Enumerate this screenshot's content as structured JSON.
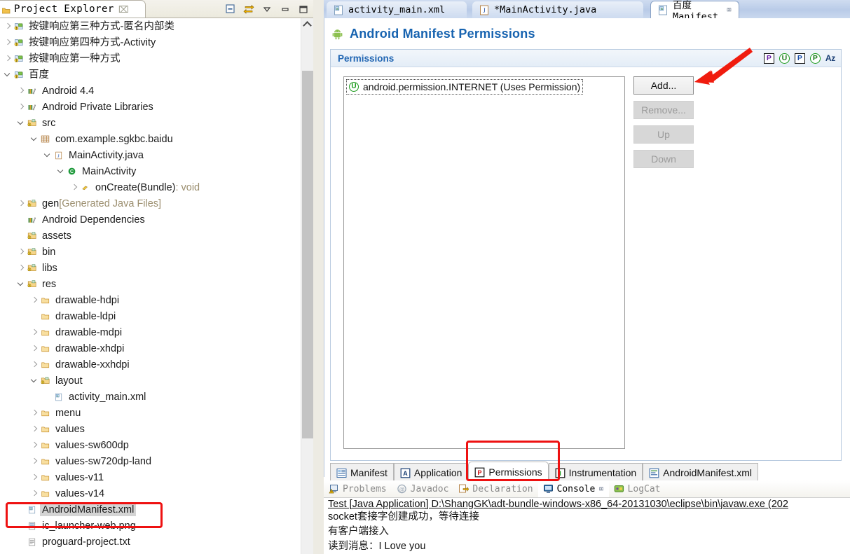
{
  "explorer": {
    "tab_label": "Project Explorer",
    "tab_close": "⌧",
    "toolbar": [
      {
        "name": "collapse-all-icon",
        "title": "Collapse All"
      },
      {
        "name": "link-with-editor-icon",
        "title": "Link with Editor"
      },
      {
        "name": "view-menu-icon",
        "title": "View Menu"
      },
      {
        "name": "minimize-icon",
        "title": "Minimize"
      },
      {
        "name": "maximize-icon",
        "title": "Maximize"
      }
    ],
    "tree": [
      {
        "label": "按键响应第三种方式-匿名内部类",
        "indent": 0,
        "twisty": "collapsed",
        "icon": "android-project",
        "selected": false
      },
      {
        "label": "按键响应第四种方式-Activity",
        "indent": 0,
        "twisty": "collapsed",
        "icon": "android-project",
        "selected": false
      },
      {
        "label": "按键响应第一种方式",
        "indent": 0,
        "twisty": "collapsed",
        "icon": "android-project",
        "selected": false
      },
      {
        "label": "百度",
        "indent": 0,
        "twisty": "expanded",
        "icon": "android-project",
        "selected": false
      },
      {
        "label": "Android 4.4",
        "indent": 1,
        "twisty": "collapsed",
        "icon": "library",
        "selected": false
      },
      {
        "label": "Android Private Libraries",
        "indent": 1,
        "twisty": "collapsed",
        "icon": "library",
        "selected": false
      },
      {
        "label": "src",
        "indent": 1,
        "twisty": "expanded",
        "icon": "source-folder",
        "selected": false
      },
      {
        "label": "com.example.sgkbc.baidu",
        "indent": 2,
        "twisty": "expanded",
        "icon": "package",
        "selected": false
      },
      {
        "label": "MainActivity.java",
        "indent": 3,
        "twisty": "expanded",
        "icon": "java-file",
        "selected": false
      },
      {
        "label": "MainActivity",
        "indent": 4,
        "twisty": "expanded",
        "icon": "java-class",
        "selected": false
      },
      {
        "label": "onCreate(Bundle)",
        "suffix": " : void",
        "indent": 5,
        "twisty": "collapsed",
        "icon": "java-method",
        "selected": false
      },
      {
        "label": "gen",
        "suffix": " [Generated Java Files]",
        "indent": 1,
        "twisty": "collapsed",
        "icon": "source-folder",
        "selected": false
      },
      {
        "label": "Android Dependencies",
        "indent": 1,
        "twisty": "none",
        "icon": "library",
        "selected": false
      },
      {
        "label": "assets",
        "indent": 1,
        "twisty": "none",
        "icon": "source-folder",
        "selected": false
      },
      {
        "label": "bin",
        "indent": 1,
        "twisty": "collapsed",
        "icon": "source-folder",
        "selected": false
      },
      {
        "label": "libs",
        "indent": 1,
        "twisty": "collapsed",
        "icon": "source-folder",
        "selected": false
      },
      {
        "label": "res",
        "indent": 1,
        "twisty": "expanded",
        "icon": "source-folder",
        "selected": false
      },
      {
        "label": "drawable-hdpi",
        "indent": 2,
        "twisty": "collapsed",
        "icon": "folder",
        "selected": false
      },
      {
        "label": "drawable-ldpi",
        "indent": 2,
        "twisty": "none",
        "icon": "folder",
        "selected": false
      },
      {
        "label": "drawable-mdpi",
        "indent": 2,
        "twisty": "collapsed",
        "icon": "folder",
        "selected": false
      },
      {
        "label": "drawable-xhdpi",
        "indent": 2,
        "twisty": "collapsed",
        "icon": "folder",
        "selected": false
      },
      {
        "label": "drawable-xxhdpi",
        "indent": 2,
        "twisty": "collapsed",
        "icon": "folder",
        "selected": false
      },
      {
        "label": "layout",
        "indent": 2,
        "twisty": "expanded",
        "icon": "source-folder",
        "selected": false
      },
      {
        "label": "activity_main.xml",
        "indent": 3,
        "twisty": "none",
        "icon": "xml-file",
        "selected": false
      },
      {
        "label": "menu",
        "indent": 2,
        "twisty": "collapsed",
        "icon": "folder",
        "selected": false
      },
      {
        "label": "values",
        "indent": 2,
        "twisty": "collapsed",
        "icon": "folder",
        "selected": false
      },
      {
        "label": "values-sw600dp",
        "indent": 2,
        "twisty": "collapsed",
        "icon": "folder",
        "selected": false
      },
      {
        "label": "values-sw720dp-land",
        "indent": 2,
        "twisty": "collapsed",
        "icon": "folder",
        "selected": false
      },
      {
        "label": "values-v11",
        "indent": 2,
        "twisty": "collapsed",
        "icon": "folder",
        "selected": false
      },
      {
        "label": "values-v14",
        "indent": 2,
        "twisty": "collapsed",
        "icon": "folder",
        "selected": false
      },
      {
        "label": "AndroidManifest.xml",
        "indent": 1,
        "twisty": "none",
        "icon": "xml-file",
        "selected": true
      },
      {
        "label": "ic_launcher-web.png",
        "indent": 1,
        "twisty": "none",
        "icon": "image-file",
        "selected": false
      },
      {
        "label": "proguard-project.txt",
        "indent": 1,
        "twisty": "none",
        "icon": "text-file",
        "selected": false
      }
    ]
  },
  "editor": {
    "tabs": [
      {
        "label": "activity_main.xml",
        "icon": "xml-file-icon",
        "active": false,
        "dirty": false
      },
      {
        "label": "*MainActivity.java",
        "icon": "java-file-icon",
        "active": false,
        "dirty": true
      },
      {
        "label": "百度 Manifest",
        "icon": "xml-file-icon",
        "active": true,
        "dirty": false,
        "close": "⌧"
      }
    ],
    "form_title": "Android Manifest Permissions",
    "section": {
      "title": "Permissions",
      "tools": [
        {
          "name": "permission-badge-icon",
          "glyph": "P",
          "style": "square-purple"
        },
        {
          "name": "uses-permission-badge-icon",
          "glyph": "U",
          "style": "circle-green"
        },
        {
          "name": "permission-group-badge-icon",
          "glyph": "P",
          "style": "square-blue"
        },
        {
          "name": "permission-tree-badge-icon",
          "glyph": "P",
          "style": "circle-green"
        },
        {
          "name": "sort-alphabetical-icon",
          "glyph": "Az",
          "style": "text"
        }
      ],
      "list_items": [
        {
          "label": "android.permission.INTERNET (Uses Permission)",
          "icon": "uses-permission-icon",
          "selected": true
        }
      ],
      "buttons": [
        {
          "label": "Add...",
          "enabled": true
        },
        {
          "label": "Remove...",
          "enabled": false
        },
        {
          "label": "Up",
          "enabled": false
        },
        {
          "label": "Down",
          "enabled": false
        }
      ]
    },
    "form_tabs": [
      {
        "label": "Manifest",
        "icon": "manifest-icon",
        "active": false
      },
      {
        "label": "Application",
        "icon": "application-icon",
        "active": false
      },
      {
        "label": "Permissions",
        "icon": "permissions-icon",
        "active": true
      },
      {
        "label": "Instrumentation",
        "icon": "instrumentation-icon",
        "active": false
      },
      {
        "label": "AndroidManifest.xml",
        "icon": "xml-source-icon",
        "active": false
      }
    ]
  },
  "bottom": {
    "tabs": [
      {
        "label": "Problems",
        "icon": "problems-icon",
        "active": false
      },
      {
        "label": "Javadoc",
        "icon": "javadoc-icon",
        "active": false
      },
      {
        "label": "Declaration",
        "icon": "declaration-icon",
        "active": false
      },
      {
        "label": "Console",
        "icon": "console-icon",
        "active": true,
        "close": "⌧"
      },
      {
        "label": "LogCat",
        "icon": "logcat-icon",
        "active": false
      }
    ],
    "console_header": "Test [Java Application] D:\\ShangGK\\adt-bundle-windows-x86_64-20131030\\eclipse\\bin\\javaw.exe (202",
    "console_lines": [
      {
        "text": "socket套接字创建成功，等待连接",
        "mono_prefix": "socket"
      },
      {
        "text": "有客户端接入"
      },
      {
        "text": "读到消息：I Love you"
      }
    ]
  },
  "annotations": {
    "manifest_file_highlight": "AndroidManifest.xml",
    "permissions_tab_highlight": "Permissions",
    "arrow_target": "Add... button"
  },
  "colors": {
    "accent_blue": "#1763b0",
    "annotation_red": "#ee1111",
    "tab_gradient_top": "#cfdcf0",
    "selection_gray": "#d4d4d4"
  }
}
